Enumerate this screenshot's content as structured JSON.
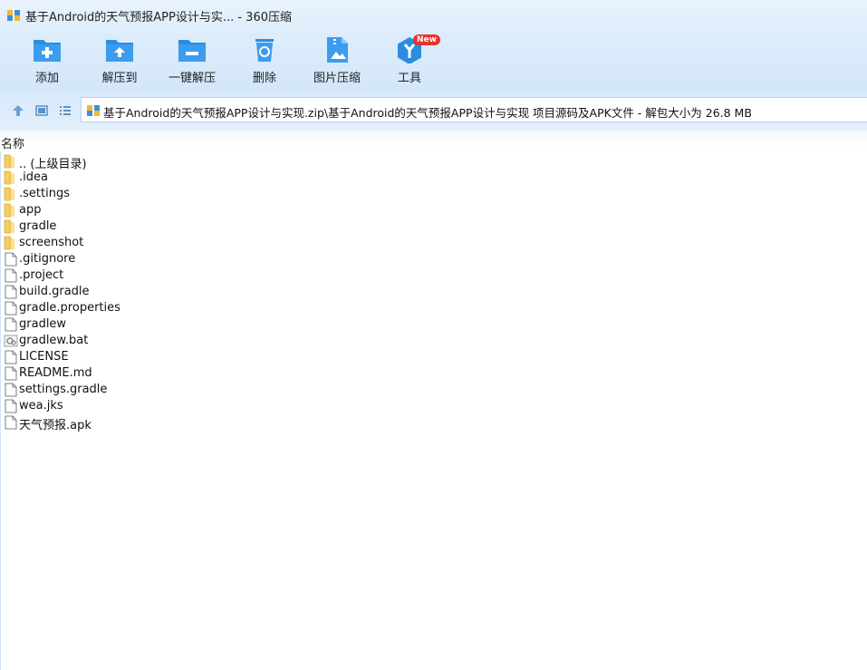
{
  "window": {
    "title": "基于Android的天气预报APP设计与实... - 360压缩"
  },
  "toolbar": {
    "items": [
      {
        "label": "添加",
        "icon": "add-folder-icon"
      },
      {
        "label": "解压到",
        "icon": "extract-to-icon"
      },
      {
        "label": "一键解压",
        "icon": "one-click-extract-icon"
      },
      {
        "label": "删除",
        "icon": "delete-bin-icon"
      },
      {
        "label": "图片压缩",
        "icon": "image-compress-icon"
      },
      {
        "label": "工具",
        "icon": "tools-icon",
        "badge": "New"
      }
    ]
  },
  "address": {
    "path": "基于Android的天气预报APP设计与实现.zip\\基于Android的天气预报APP设计与实现 项目源码及APK文件 - 解包大小为 26.8 MB"
  },
  "list": {
    "column_name": "名称",
    "items": [
      {
        "name": ".. (上级目录)",
        "type": "folder"
      },
      {
        "name": ".idea",
        "type": "folder"
      },
      {
        "name": ".settings",
        "type": "folder"
      },
      {
        "name": "app",
        "type": "folder"
      },
      {
        "name": "gradle",
        "type": "folder"
      },
      {
        "name": "screenshot",
        "type": "folder"
      },
      {
        "name": ".gitignore",
        "type": "file"
      },
      {
        "name": ".project",
        "type": "file"
      },
      {
        "name": "build.gradle",
        "type": "file"
      },
      {
        "name": "gradle.properties",
        "type": "file"
      },
      {
        "name": "gradlew",
        "type": "file"
      },
      {
        "name": "gradlew.bat",
        "type": "bat"
      },
      {
        "name": "LICENSE",
        "type": "file"
      },
      {
        "name": "README.md",
        "type": "file"
      },
      {
        "name": "settings.gradle",
        "type": "file"
      },
      {
        "name": "wea.jks",
        "type": "file"
      },
      {
        "name": "天气预报.apk",
        "type": "file"
      }
    ]
  },
  "colors": {
    "accent": "#2b8de0",
    "folder": "#f6cf5e",
    "badge": "#e8332f"
  }
}
